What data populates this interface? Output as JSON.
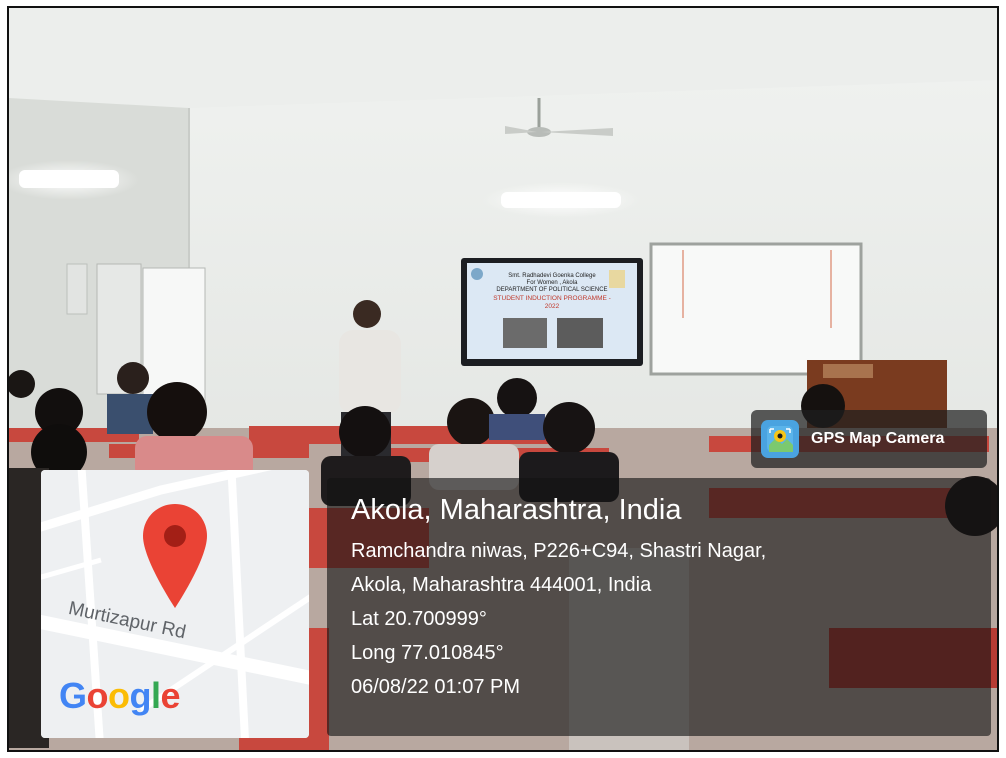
{
  "badge": {
    "label": "GPS Map Camera",
    "icon": "gps-camera-icon"
  },
  "location": {
    "title": "Akola, Maharashtra, India",
    "address_line1": "Ramchandra niwas, P226+C94, Shastri Nagar,",
    "address_line2": "Akola, Maharashtra 444001, India",
    "lat": "Lat 20.700999°",
    "long": "Long 77.010845°",
    "datetime": "06/08/22 01:07 PM"
  },
  "map": {
    "road_label": "Murtizapur Rd",
    "logo_letters": [
      "G",
      "o",
      "o",
      "g",
      "l",
      "e"
    ],
    "logo_colors": [
      "#4285F4",
      "#EA4335",
      "#FBBC05",
      "#4285F4",
      "#34A853",
      "#EA4335"
    ],
    "pin_color": "#EA4335"
  },
  "slide": {
    "college": "Smt. Radhadevi Goenka College",
    "college2": "For Women , Akola",
    "dept": "DEPARTMENT OF POLITICAL SCIENCE",
    "programme": "STUDENT INDUCTION PROGRAMME -",
    "year": "2022"
  }
}
